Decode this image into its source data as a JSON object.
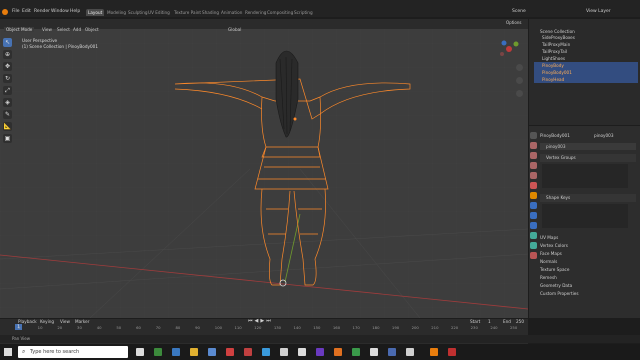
{
  "menus": [
    "File",
    "Edit",
    "Render",
    "Window",
    "Help"
  ],
  "workspaces": [
    {
      "label": "Layout",
      "active": true
    },
    {
      "label": "Modeling",
      "active": false
    },
    {
      "label": "Sculpting",
      "active": false
    },
    {
      "label": "UV Editing",
      "active": false
    },
    {
      "label": "Texture Paint",
      "active": false
    },
    {
      "label": "Shading",
      "active": false
    },
    {
      "label": "Animation",
      "active": false
    },
    {
      "label": "Rendering",
      "active": false
    },
    {
      "label": "Compositing",
      "active": false
    },
    {
      "label": "Scripting",
      "active": false
    }
  ],
  "scene": "Scene",
  "view_layer": "View Layer",
  "viewport": {
    "mode": "Object Mode",
    "menu": [
      "View",
      "Select",
      "Add",
      "Object"
    ],
    "transform": "Global",
    "info_line1": "User Perspective",
    "info_line2": "(1) Scene Collection | PinoyBody001",
    "options": "Options"
  },
  "outliner": {
    "title": "Scene Collection",
    "items": [
      {
        "label": "SideProxyBoxes",
        "selected": false
      },
      {
        "label": "TailProxyMain",
        "selected": false
      },
      {
        "label": "TailProxyTail",
        "selected": false
      },
      {
        "label": "LightShoes",
        "selected": false
      },
      {
        "label": "PinoyBody",
        "selected": true
      },
      {
        "label": "PinoyBody001",
        "selected": true
      },
      {
        "label": "PinoyHead",
        "selected": true
      }
    ]
  },
  "properties": {
    "object_name": "PinoyBody001",
    "data_name": "pinoy003",
    "data_field": "pinoy003",
    "sections": [
      {
        "label": "Vertex Groups",
        "expanded": true
      },
      {
        "label": "Shape Keys",
        "expanded": true
      }
    ],
    "collapsed": [
      "UV Maps",
      "Vertex Colors",
      "Face Maps",
      "Normals",
      "Texture Space",
      "Remesh",
      "Geometry Data",
      "Custom Properties"
    ]
  },
  "timeline": {
    "menu": [
      "Playback",
      "Keying",
      "View",
      "Marker"
    ],
    "current_frame": "1",
    "start_label": "Start",
    "start": "1",
    "end_label": "End",
    "end": "250",
    "ticks": [
      "0",
      "10",
      "20",
      "30",
      "40",
      "50",
      "60",
      "70",
      "80",
      "90",
      "100",
      "110",
      "120",
      "130",
      "140",
      "150",
      "160",
      "170",
      "180",
      "190",
      "200",
      "210",
      "220",
      "230",
      "240",
      "250"
    ]
  },
  "status": {
    "left": "Pan View"
  },
  "taskbar": {
    "search_placeholder": "Type here to search"
  },
  "colors": {
    "accent": "#4772b3",
    "selection": "#ff8a2a",
    "x_axis": "#a03c3c",
    "y_axis": "#6f9a2d"
  }
}
